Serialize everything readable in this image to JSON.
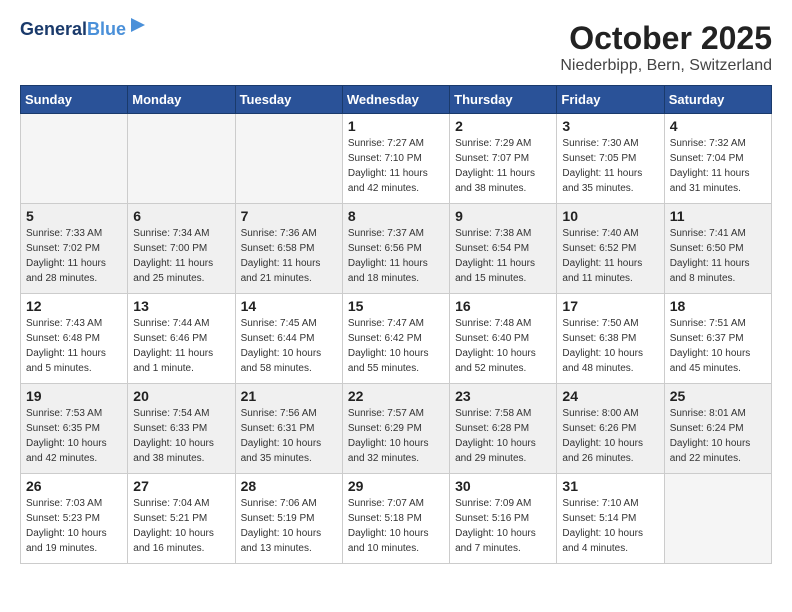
{
  "header": {
    "logo_line1": "General",
    "logo_line2": "Blue",
    "month": "October 2025",
    "location": "Niederbipp, Bern, Switzerland"
  },
  "weekdays": [
    "Sunday",
    "Monday",
    "Tuesday",
    "Wednesday",
    "Thursday",
    "Friday",
    "Saturday"
  ],
  "rows": [
    [
      {
        "day": "",
        "info": ""
      },
      {
        "day": "",
        "info": ""
      },
      {
        "day": "",
        "info": ""
      },
      {
        "day": "1",
        "info": "Sunrise: 7:27 AM\nSunset: 7:10 PM\nDaylight: 11 hours\nand 42 minutes."
      },
      {
        "day": "2",
        "info": "Sunrise: 7:29 AM\nSunset: 7:07 PM\nDaylight: 11 hours\nand 38 minutes."
      },
      {
        "day": "3",
        "info": "Sunrise: 7:30 AM\nSunset: 7:05 PM\nDaylight: 11 hours\nand 35 minutes."
      },
      {
        "day": "4",
        "info": "Sunrise: 7:32 AM\nSunset: 7:04 PM\nDaylight: 11 hours\nand 31 minutes."
      }
    ],
    [
      {
        "day": "5",
        "info": "Sunrise: 7:33 AM\nSunset: 7:02 PM\nDaylight: 11 hours\nand 28 minutes."
      },
      {
        "day": "6",
        "info": "Sunrise: 7:34 AM\nSunset: 7:00 PM\nDaylight: 11 hours\nand 25 minutes."
      },
      {
        "day": "7",
        "info": "Sunrise: 7:36 AM\nSunset: 6:58 PM\nDaylight: 11 hours\nand 21 minutes."
      },
      {
        "day": "8",
        "info": "Sunrise: 7:37 AM\nSunset: 6:56 PM\nDaylight: 11 hours\nand 18 minutes."
      },
      {
        "day": "9",
        "info": "Sunrise: 7:38 AM\nSunset: 6:54 PM\nDaylight: 11 hours\nand 15 minutes."
      },
      {
        "day": "10",
        "info": "Sunrise: 7:40 AM\nSunset: 6:52 PM\nDaylight: 11 hours\nand 11 minutes."
      },
      {
        "day": "11",
        "info": "Sunrise: 7:41 AM\nSunset: 6:50 PM\nDaylight: 11 hours\nand 8 minutes."
      }
    ],
    [
      {
        "day": "12",
        "info": "Sunrise: 7:43 AM\nSunset: 6:48 PM\nDaylight: 11 hours\nand 5 minutes."
      },
      {
        "day": "13",
        "info": "Sunrise: 7:44 AM\nSunset: 6:46 PM\nDaylight: 11 hours\nand 1 minute."
      },
      {
        "day": "14",
        "info": "Sunrise: 7:45 AM\nSunset: 6:44 PM\nDaylight: 10 hours\nand 58 minutes."
      },
      {
        "day": "15",
        "info": "Sunrise: 7:47 AM\nSunset: 6:42 PM\nDaylight: 10 hours\nand 55 minutes."
      },
      {
        "day": "16",
        "info": "Sunrise: 7:48 AM\nSunset: 6:40 PM\nDaylight: 10 hours\nand 52 minutes."
      },
      {
        "day": "17",
        "info": "Sunrise: 7:50 AM\nSunset: 6:38 PM\nDaylight: 10 hours\nand 48 minutes."
      },
      {
        "day": "18",
        "info": "Sunrise: 7:51 AM\nSunset: 6:37 PM\nDaylight: 10 hours\nand 45 minutes."
      }
    ],
    [
      {
        "day": "19",
        "info": "Sunrise: 7:53 AM\nSunset: 6:35 PM\nDaylight: 10 hours\nand 42 minutes."
      },
      {
        "day": "20",
        "info": "Sunrise: 7:54 AM\nSunset: 6:33 PM\nDaylight: 10 hours\nand 38 minutes."
      },
      {
        "day": "21",
        "info": "Sunrise: 7:56 AM\nSunset: 6:31 PM\nDaylight: 10 hours\nand 35 minutes."
      },
      {
        "day": "22",
        "info": "Sunrise: 7:57 AM\nSunset: 6:29 PM\nDaylight: 10 hours\nand 32 minutes."
      },
      {
        "day": "23",
        "info": "Sunrise: 7:58 AM\nSunset: 6:28 PM\nDaylight: 10 hours\nand 29 minutes."
      },
      {
        "day": "24",
        "info": "Sunrise: 8:00 AM\nSunset: 6:26 PM\nDaylight: 10 hours\nand 26 minutes."
      },
      {
        "day": "25",
        "info": "Sunrise: 8:01 AM\nSunset: 6:24 PM\nDaylight: 10 hours\nand 22 minutes."
      }
    ],
    [
      {
        "day": "26",
        "info": "Sunrise: 7:03 AM\nSunset: 5:23 PM\nDaylight: 10 hours\nand 19 minutes."
      },
      {
        "day": "27",
        "info": "Sunrise: 7:04 AM\nSunset: 5:21 PM\nDaylight: 10 hours\nand 16 minutes."
      },
      {
        "day": "28",
        "info": "Sunrise: 7:06 AM\nSunset: 5:19 PM\nDaylight: 10 hours\nand 13 minutes."
      },
      {
        "day": "29",
        "info": "Sunrise: 7:07 AM\nSunset: 5:18 PM\nDaylight: 10 hours\nand 10 minutes."
      },
      {
        "day": "30",
        "info": "Sunrise: 7:09 AM\nSunset: 5:16 PM\nDaylight: 10 hours\nand 7 minutes."
      },
      {
        "day": "31",
        "info": "Sunrise: 7:10 AM\nSunset: 5:14 PM\nDaylight: 10 hours\nand 4 minutes."
      },
      {
        "day": "",
        "info": ""
      }
    ]
  ]
}
